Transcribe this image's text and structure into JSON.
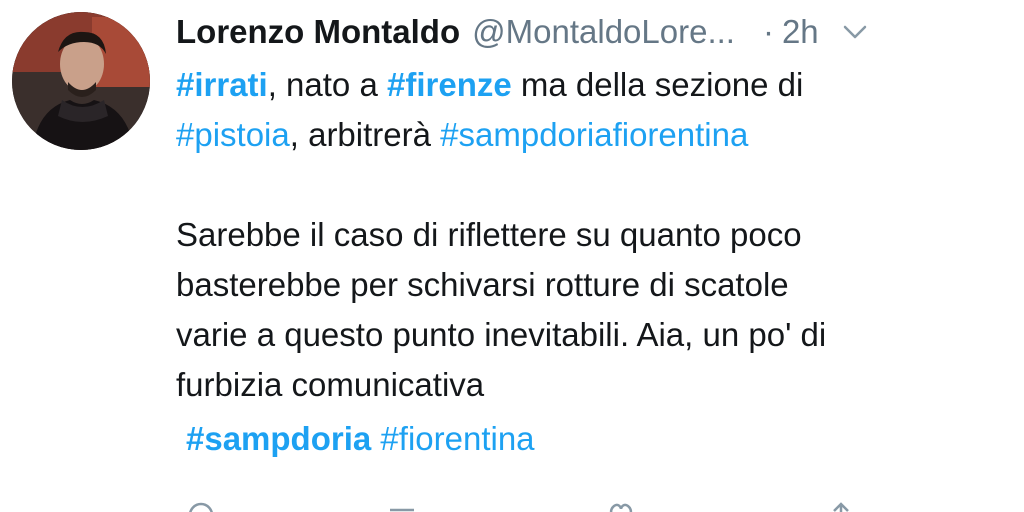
{
  "tweet": {
    "author_name": "Lorenzo Montaldo",
    "handle": "@MontaldoLore...",
    "separator": "·",
    "time": "2h",
    "menu_icon": "chevron-down-icon",
    "avatar_icon": "profile-photo",
    "text": {
      "l1_tag1": "#irrati",
      "l1_mid": ", nato a ",
      "l1_tag2": "#firenze",
      "l1_end": " ma della sezione di",
      "l2_tag1": "#pistoia",
      "l2_mid": ", arbitrerà ",
      "l2_tag2": "#sampdoriafiorentina",
      "p2_line1": "Sarebbe il caso di riflettere su quanto poco",
      "p2_line2": "basterebbe per schivarsi rotture di scatole",
      "p2_line3": "varie a questo punto inevitabili. Aia, un po' di",
      "p2_line4": "furbizia comunicativa",
      "tag_a": "#sampdoria",
      "tag_b": "#fiorentina"
    }
  },
  "colors": {
    "hashtag": "#1da1f2",
    "muted": "#657786",
    "text": "#14171a"
  }
}
